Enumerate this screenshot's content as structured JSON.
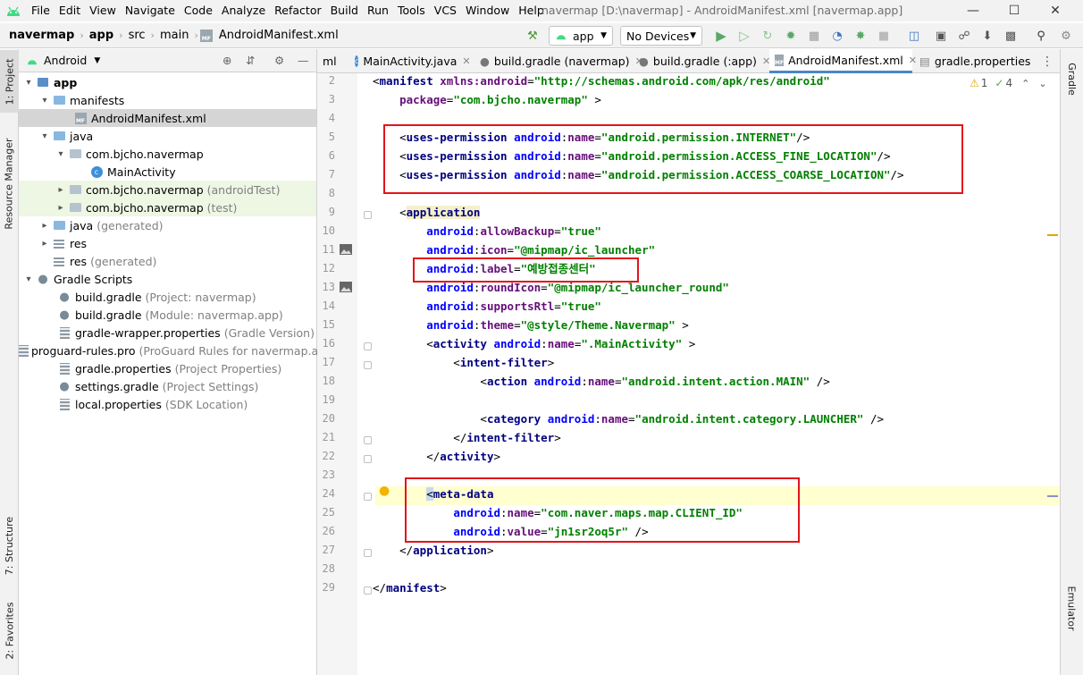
{
  "menubar": {
    "items": [
      "File",
      "Edit",
      "View",
      "Navigate",
      "Code",
      "Analyze",
      "Refactor",
      "Build",
      "Run",
      "Tools",
      "VCS",
      "Window",
      "Help"
    ],
    "title": "navermap [D:\\navermap] - AndroidManifest.xml [navermap.app]"
  },
  "breadcrumb": [
    "navermap",
    "app",
    "src",
    "main",
    "AndroidManifest.xml"
  ],
  "toolbar": {
    "run_config": "app",
    "device": "No Devices"
  },
  "side_tabs": {
    "project": "1: Project",
    "resource_manager": "Resource Manager",
    "structure": "7: Structure",
    "favorites": "2: Favorites",
    "gradle": "Gradle",
    "emulator": "Emulator"
  },
  "project_panel": {
    "view": "Android"
  },
  "tree": [
    {
      "label": "app",
      "extra": "",
      "bold": true
    },
    {
      "label": "manifests",
      "extra": ""
    },
    {
      "label": "AndroidManifest.xml",
      "extra": ""
    },
    {
      "label": "java",
      "extra": ""
    },
    {
      "label": "com.bjcho.navermap",
      "extra": ""
    },
    {
      "label": "MainActivity",
      "extra": ""
    },
    {
      "label": "com.bjcho.navermap",
      "extra": "(androidTest)"
    },
    {
      "label": "com.bjcho.navermap",
      "extra": "(test)"
    },
    {
      "label": "java",
      "extra": "(generated)"
    },
    {
      "label": "res",
      "extra": ""
    },
    {
      "label": "res",
      "extra": "(generated)"
    },
    {
      "label": "Gradle Scripts",
      "extra": ""
    },
    {
      "label": "build.gradle",
      "extra": "(Project: navermap)"
    },
    {
      "label": "build.gradle",
      "extra": "(Module: navermap.app)"
    },
    {
      "label": "gradle-wrapper.properties",
      "extra": "(Gradle Version)"
    },
    {
      "label": "proguard-rules.pro",
      "extra": "(ProGuard Rules for navermap.a"
    },
    {
      "label": "gradle.properties",
      "extra": "(Project Properties)"
    },
    {
      "label": "settings.gradle",
      "extra": "(Project Settings)"
    },
    {
      "label": "local.properties",
      "extra": "(SDK Location)"
    }
  ],
  "tabs": [
    {
      "label": "ml"
    },
    {
      "label": "MainActivity.java"
    },
    {
      "label": "build.gradle (navermap)"
    },
    {
      "label": "build.gradle (:app)"
    },
    {
      "label": "AndroidManifest.xml"
    },
    {
      "label": "gradle.properties"
    }
  ],
  "inspections": {
    "warnings": "1",
    "weak": "4"
  },
  "code": {
    "line_numbers": [
      "2",
      "3",
      "4",
      "5",
      "6",
      "7",
      "8",
      "9",
      "10",
      "11",
      "12",
      "13",
      "14",
      "15",
      "16",
      "17",
      "18",
      "19",
      "20",
      "21",
      "22",
      "23",
      "24",
      "25",
      "26",
      "27",
      "28",
      "29"
    ],
    "manifest_tag": "manifest",
    "xmlns_attr": "xmlns:android",
    "xmlns_val": "\"http://schemas.android.com/apk/res/android\"",
    "package_attr": "package",
    "package_val": "\"com.bjcho.navermap\"",
    "perm_tag": "uses-permission",
    "name_attr": "name",
    "perm1": "\"android.permission.INTERNET\"",
    "perm2": "\"android.permission.ACCESS_FINE_LOCATION\"",
    "perm3": "\"android.permission.ACCESS_COARSE_LOCATION\"",
    "app_tag": "application",
    "allowBackup": "allowBackup",
    "allowBackup_val": "\"true\"",
    "icon": "icon",
    "icon_val": "\"@mipmap/ic_launcher\"",
    "label": "label",
    "label_val": "\"예방접종센터\"",
    "roundIcon": "roundIcon",
    "roundIcon_val": "\"@mipmap/ic_launcher_round\"",
    "supportsRtl": "supportsRtl",
    "supportsRtl_val": "\"true\"",
    "theme": "theme",
    "theme_val": "\"@style/Theme.Navermap\"",
    "activity_tag": "activity",
    "activity_val": "\".MainActivity\"",
    "intent_tag": "intent-filter",
    "action_tag": "action",
    "action_val": "\"android.intent.action.MAIN\"",
    "category_tag": "category",
    "category_val": "\"android.intent.category.LAUNCHER\"",
    "meta_tag": "meta-data",
    "meta_name_val": "\"com.naver.maps.map.CLIENT_ID\"",
    "value_attr": "value",
    "meta_value_val": "\"jn1sr2oq5r\"",
    "android": "android"
  }
}
